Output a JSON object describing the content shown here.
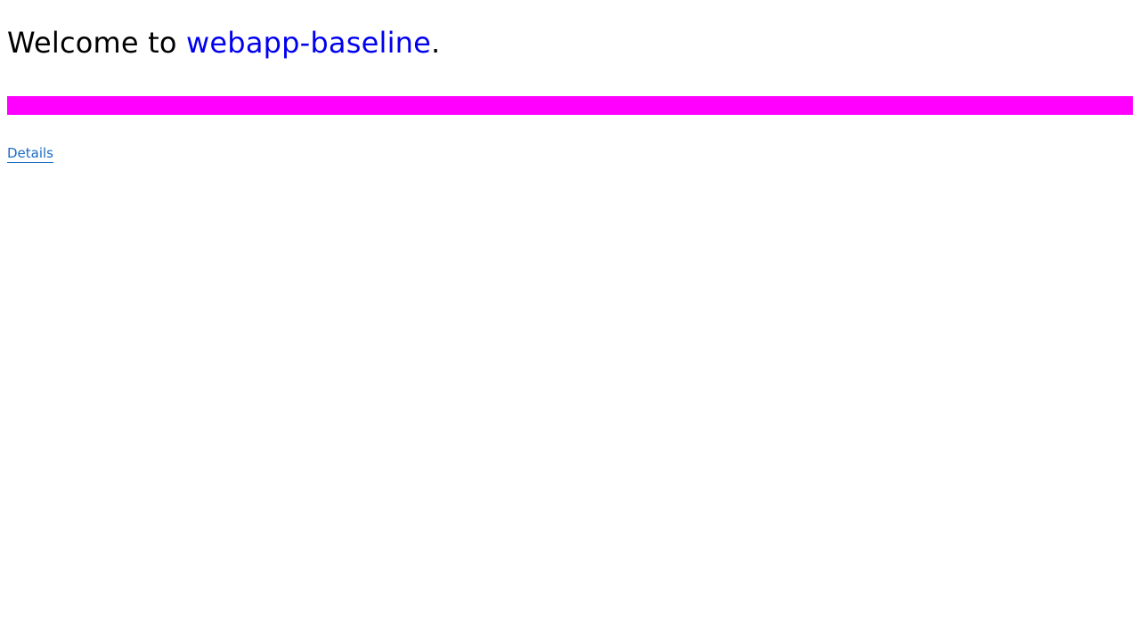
{
  "welcome": {
    "prefix": "Welcome to ",
    "app_name": "webapp-baseline",
    "suffix": "."
  },
  "banner": {
    "color": "#ff00ff"
  },
  "details_link": {
    "label": "Details",
    "color": "#1a6dc4"
  }
}
